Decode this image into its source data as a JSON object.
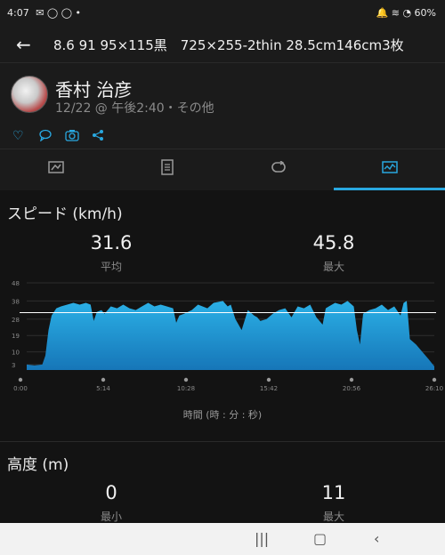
{
  "status_bar": {
    "time": "4:07",
    "left_icons": "✉ ◯ ◯ •",
    "right_icons": "🔔 ≋ ◔ 60%"
  },
  "app_bar": {
    "title": "8.6 91 95×115黒　725×255-2thin 28.5cm146cm3枚"
  },
  "profile": {
    "name": "香村 治彦",
    "meta": "12/22 @ 午後2:40・その他"
  },
  "action_icons": [
    "heart-icon",
    "comment-icon",
    "camera-icon",
    "share-icon"
  ],
  "tabs": [
    "map",
    "list",
    "laps",
    "graph"
  ],
  "speed": {
    "title": "スピード (km/h)",
    "avg_value": "31.6",
    "avg_label": "平均",
    "max_value": "45.8",
    "max_label": "最大"
  },
  "altitude": {
    "title": "高度 (m)",
    "min_value": "0",
    "min_label": "最小",
    "max_value": "11",
    "max_label": "最大"
  },
  "chart_data": {
    "type": "area",
    "xlabel": "時間 (時 : 分 : 秒)",
    "x_ticks": [
      "0:00",
      "5:14",
      "10:28",
      "15:42",
      "20:56",
      "26:10"
    ],
    "y_ticks": [
      3,
      10,
      19,
      28,
      38,
      48
    ],
    "ylim": [
      0,
      48
    ],
    "avg_line": 31.6,
    "x_minutes": [
      0,
      0.5,
      1.0,
      1.2,
      1.4,
      1.6,
      1.9,
      2.2,
      2.6,
      3.0,
      3.4,
      3.8,
      4.1,
      4.3,
      4.5,
      4.8,
      5.0,
      5.4,
      5.8,
      6.2,
      6.6,
      7.0,
      7.4,
      7.8,
      8.2,
      8.6,
      9.0,
      9.4,
      9.6,
      9.8,
      10.1,
      10.6,
      11.0,
      11.6,
      12.0,
      12.6,
      12.9,
      13.1,
      13.4,
      13.8,
      14.2,
      14.6,
      14.8,
      15.0,
      15.4,
      15.8,
      16.2,
      16.6,
      17.0,
      17.4,
      17.8,
      18.2,
      18.6,
      19.0,
      19.2,
      19.4,
      19.8,
      20.2,
      20.6,
      21.0,
      21.2,
      21.4,
      21.6,
      22.0,
      22.4,
      22.8,
      23.2,
      23.6,
      24.0,
      24.2,
      24.4,
      24.6,
      25.0,
      25.4,
      25.8,
      26.17
    ],
    "y_values": [
      3,
      2.5,
      3,
      8,
      22,
      30,
      34,
      35,
      36,
      37,
      36,
      37,
      36,
      27,
      32,
      33,
      31,
      35,
      34,
      36,
      34,
      33,
      35,
      37,
      35,
      36,
      35,
      34,
      26,
      30,
      31,
      33,
      36,
      34,
      37,
      38,
      35,
      36,
      28,
      22,
      33,
      30,
      29,
      27,
      28,
      31,
      33,
      34,
      29,
      35,
      34,
      36,
      29,
      25,
      34,
      35,
      37,
      36,
      38,
      35,
      22,
      14,
      31,
      33,
      34,
      36,
      33,
      35,
      30,
      37,
      38,
      17,
      14,
      10,
      6,
      2
    ]
  }
}
